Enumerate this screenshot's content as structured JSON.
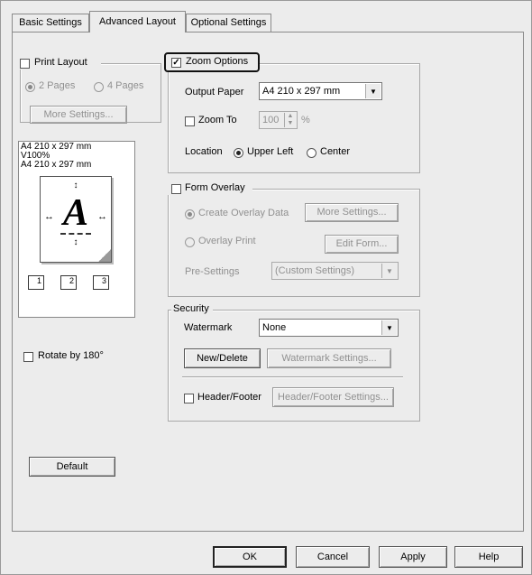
{
  "tabs": [
    {
      "label": "Basic Settings"
    },
    {
      "label": "Advanced Layout"
    },
    {
      "label": "Optional Settings"
    }
  ],
  "print_layout": {
    "label": "Print Layout",
    "checked": false,
    "pages2": "2 Pages",
    "pages4": "4 Pages",
    "more_settings": "More Settings..."
  },
  "preview": {
    "line1": "A4 210 x 297 mm",
    "line2": "V100%",
    "line3": "A4 210 x 297 mm",
    "glyph": "A",
    "stack1": "1",
    "stack2": "2",
    "stack3": "3"
  },
  "rotate": {
    "label": "Rotate by 180°"
  },
  "zoom_options": {
    "label": "Zoom Options",
    "output_paper_label": "Output Paper",
    "output_paper_value": "A4 210 x 297 mm",
    "zoom_to_label": "Zoom To",
    "zoom_to_value": "100",
    "zoom_unit": "%",
    "location_label": "Location",
    "upper_left": "Upper Left",
    "center": "Center"
  },
  "form_overlay": {
    "label": "Form Overlay",
    "create_overlay": "Create Overlay Data",
    "more_settings": "More Settings...",
    "overlay_print": "Overlay Print",
    "edit_form": "Edit Form...",
    "presettings_label": "Pre-Settings",
    "presettings_value": "(Custom Settings)"
  },
  "security": {
    "title": "Security",
    "watermark_label": "Watermark",
    "watermark_value": "None",
    "new_delete": "New/Delete",
    "watermark_settings": "Watermark Settings...",
    "header_footer_label": "Header/Footer",
    "header_footer_settings": "Header/Footer Settings..."
  },
  "buttons": {
    "default": "Default",
    "ok": "OK",
    "cancel": "Cancel",
    "apply": "Apply",
    "help": "Help"
  },
  "colors": {
    "dialog_bg": "#ececec",
    "highlight_border": "#111111"
  }
}
